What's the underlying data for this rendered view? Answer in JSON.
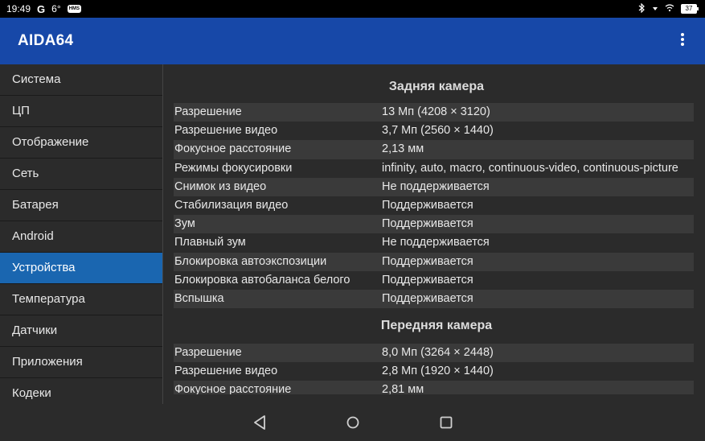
{
  "status": {
    "time": "19:49",
    "google": "G",
    "temp": "6°",
    "badge": "HMS",
    "battery": "37"
  },
  "app": {
    "title": "AIDA64"
  },
  "sidebar": {
    "items": [
      {
        "label": "Система"
      },
      {
        "label": "ЦП"
      },
      {
        "label": "Отображение"
      },
      {
        "label": "Сеть"
      },
      {
        "label": "Батарея"
      },
      {
        "label": "Android"
      },
      {
        "label": "Устройства",
        "active": true
      },
      {
        "label": "Температура"
      },
      {
        "label": "Датчики"
      },
      {
        "label": "Приложения"
      },
      {
        "label": "Кодеки"
      }
    ]
  },
  "rear": {
    "title": "Задняя камера",
    "rows": [
      {
        "k": "Разрешение",
        "v": "13 Мп (4208 × 3120)"
      },
      {
        "k": "Разрешение видео",
        "v": "3,7 Мп (2560 × 1440)"
      },
      {
        "k": "Фокусное расстояние",
        "v": "2,13 мм"
      },
      {
        "k": "Режимы фокусировки",
        "v": "infinity, auto, macro, continuous-video, continuous-picture"
      },
      {
        "k": "Снимок из видео",
        "v": "Не поддерживается"
      },
      {
        "k": "Стабилизация видео",
        "v": "Поддерживается"
      },
      {
        "k": "Зум",
        "v": "Поддерживается"
      },
      {
        "k": "Плавный зум",
        "v": "Не поддерживается"
      },
      {
        "k": "Блокировка автоэкспозиции",
        "v": "Поддерживается"
      },
      {
        "k": "Блокировка автобаланса белого",
        "v": "Поддерживается"
      },
      {
        "k": "Вспышка",
        "v": "Поддерживается"
      }
    ]
  },
  "front": {
    "title": "Передняя камера",
    "rows": [
      {
        "k": "Разрешение",
        "v": "8,0 Мп (3264 × 2448)"
      },
      {
        "k": "Разрешение видео",
        "v": "2,8 Мп (1920 × 1440)"
      },
      {
        "k": "Фокусное расстояние",
        "v": "2,81 мм"
      }
    ]
  },
  "nav": {
    "back_icon": "back-triangle",
    "home_icon": "home-circle",
    "recents_icon": "recents-square"
  }
}
